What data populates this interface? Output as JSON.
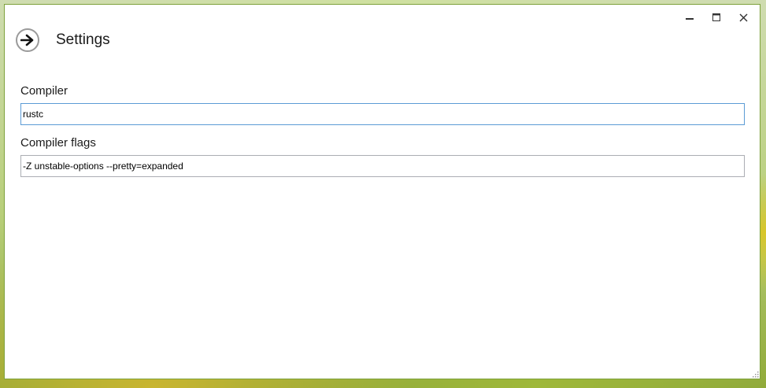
{
  "window": {
    "controls": {
      "minimize_icon": "minimize-icon",
      "maximize_icon": "maximize-icon",
      "close_icon": "close-icon"
    }
  },
  "header": {
    "back_icon": "arrow-right-circle-icon",
    "title": "Settings"
  },
  "form": {
    "compiler": {
      "label": "Compiler",
      "value": "rustc"
    },
    "compiler_flags": {
      "label": "Compiler flags",
      "value": "-Z unstable-options --pretty=expanded"
    }
  },
  "colors": {
    "window_border": "#7ea23c",
    "input_focus_border": "#5b9bd5",
    "input_border": "#abadb3"
  }
}
